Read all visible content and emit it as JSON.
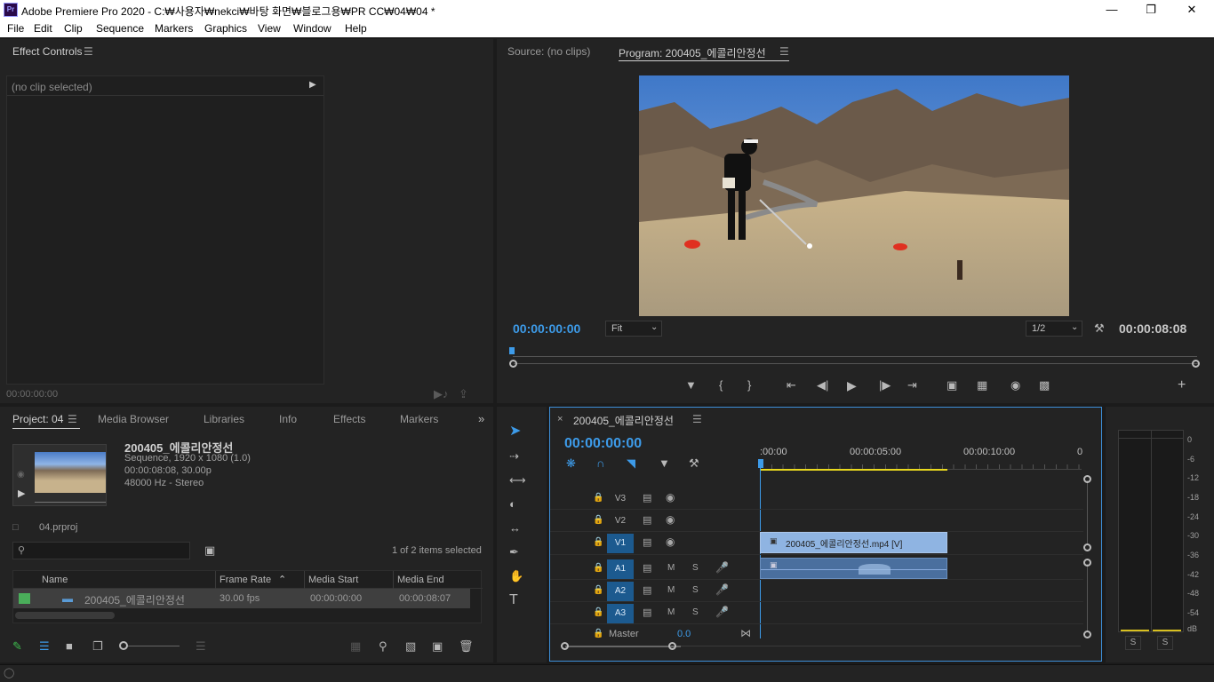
{
  "window": {
    "title": "Adobe Premiere Pro 2020 - C:₩사용자₩nekci₩바탕 화면₩블로그용₩PR CC₩04₩04 *",
    "logo": "Pr"
  },
  "menu": [
    "File",
    "Edit",
    "Clip",
    "Sequence",
    "Markers",
    "Graphics",
    "View",
    "Window",
    "Help"
  ],
  "effect_controls": {
    "tab": "Effect Controls",
    "no_clip": "(no clip selected)",
    "timecode": "00:00:00:00"
  },
  "monitor": {
    "source_tab": "Source: (no clips)",
    "program_tab": "Program: 200405_에콜리안정선",
    "timecode_left": "00:00:00:00",
    "fit": "Fit",
    "resolution": "1/2",
    "timecode_right": "00:00:08:08"
  },
  "project": {
    "tabs": [
      "Project: 04",
      "Media Browser",
      "Libraries",
      "Info",
      "Effects",
      "Markers"
    ],
    "clip_name": "200405_에콜리안정선",
    "clip_info": [
      "Sequence, 1920 x 1080 (1.0)",
      "00:00:08:08, 30.00p",
      "48000 Hz - Stereo"
    ],
    "file": "04.prproj",
    "selection": "1 of 2 items selected",
    "columns": [
      "Name",
      "Frame Rate",
      "Media Start",
      "Media End"
    ],
    "rows": [
      {
        "name": "200405_에콜리안정선",
        "frame_rate": "30.00 fps",
        "media_start": "00:00:00:00",
        "media_end": "00:00:08:07"
      }
    ]
  },
  "timeline": {
    "tab": "200405_에콜리안정선",
    "timecode": "00:00:00:00",
    "ruler": [
      ":00:00",
      "00:00:05:00",
      "00:00:10:00",
      "0"
    ],
    "video_tracks": [
      "V3",
      "V2",
      "V1"
    ],
    "audio_tracks": [
      "A1",
      "A2",
      "A3"
    ],
    "master": "Master",
    "master_value": "0.0",
    "video_clip": "200405_에콜리안정선.mp4 [V]"
  },
  "meter": {
    "scale": [
      "0",
      "-6",
      "-12",
      "-18",
      "-24",
      "-30",
      "-36",
      "-42",
      "-48",
      "-54",
      "dB"
    ],
    "solo": [
      "S",
      "S"
    ]
  },
  "colors": {
    "accent": "#3d9be9",
    "clip": "#8fb4e2",
    "panel": "#232323"
  }
}
